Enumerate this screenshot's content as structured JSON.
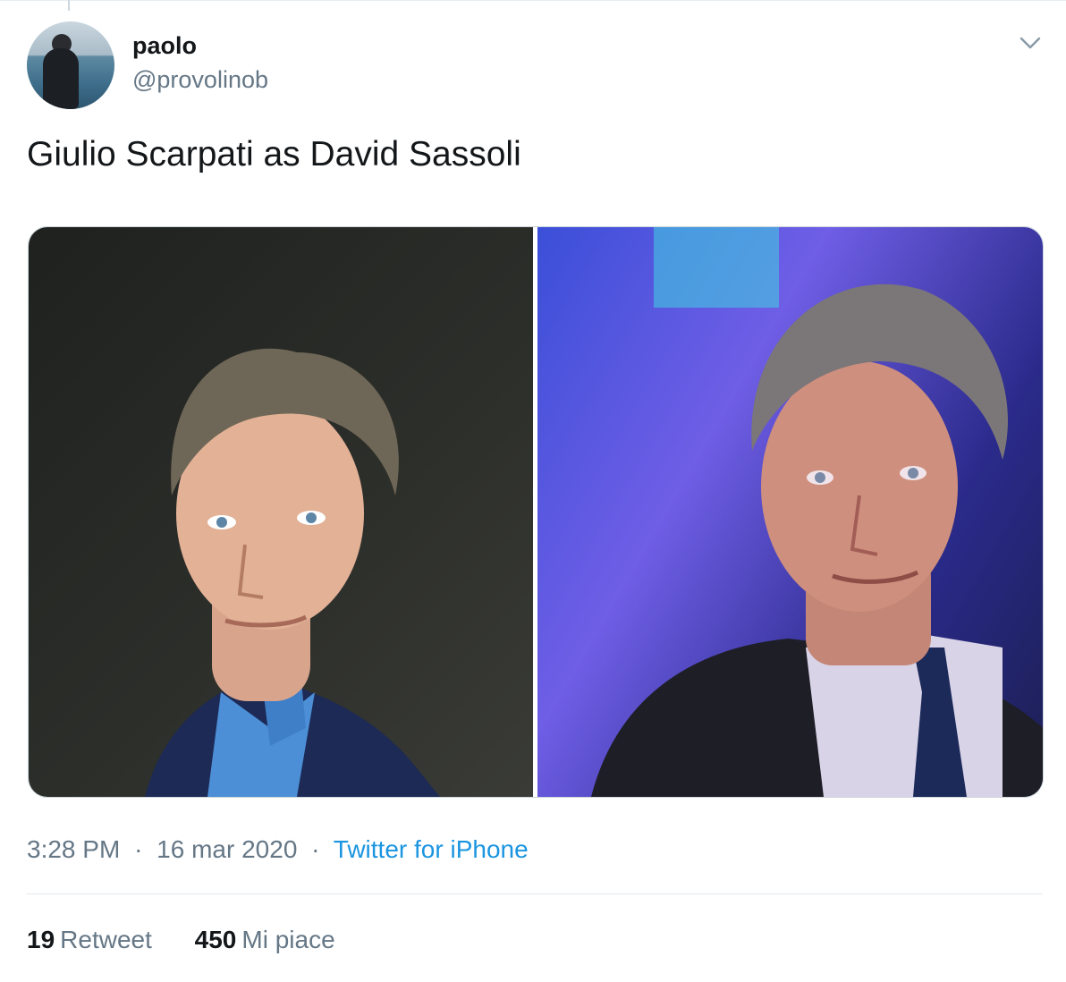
{
  "tweet": {
    "author": {
      "display_name": "paolo",
      "handle": "@provolinob"
    },
    "text": "Giulio Scarpati as David Sassoli",
    "media": [
      {
        "icon": "photo-portrait"
      },
      {
        "icon": "photo-portrait"
      }
    ],
    "meta": {
      "time": "3:28 PM",
      "separator": "·",
      "date": "16 mar 2020",
      "source": "Twitter for iPhone"
    },
    "stats": {
      "retweets_count": "19",
      "retweets_label": "Retweet",
      "likes_count": "450",
      "likes_label": "Mi piace"
    }
  },
  "colors": {
    "text": "#14171a",
    "secondary": "#657786",
    "link": "#1b95e0",
    "border": "#e1e8ed"
  }
}
